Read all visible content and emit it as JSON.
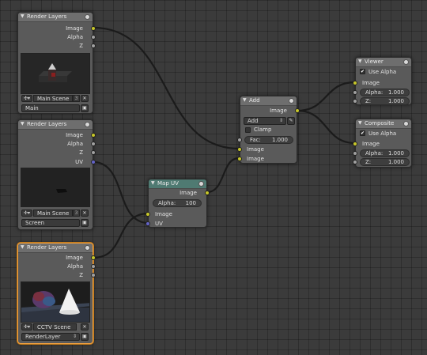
{
  "nodes": {
    "render_layers_1": {
      "title": "Render Layers",
      "outputs": [
        "Image",
        "Alpha",
        "Z"
      ],
      "scene": "Main Scene",
      "layer": "Main"
    },
    "render_layers_2": {
      "title": "Render Layers",
      "outputs": [
        "Image",
        "Alpha",
        "Z",
        "UV"
      ],
      "scene": "Main Scene",
      "layer": "Screen"
    },
    "render_layers_3": {
      "title": "Render Layers",
      "outputs": [
        "Image",
        "Alpha",
        "Z"
      ],
      "scene": "CCTV Scene",
      "layer": "RenderLayer"
    },
    "map_uv": {
      "title": "Map UV",
      "output": "Image",
      "alpha_label": "Alpha:",
      "alpha_value": "100",
      "inputs": [
        "Image",
        "UV"
      ]
    },
    "add": {
      "title": "Add",
      "output": "Image",
      "blend_mode": "Add",
      "clamp_label": "Clamp",
      "fac_label": "Fac:",
      "fac_value": "1.000",
      "inputs": [
        "Image",
        "Image"
      ]
    },
    "viewer": {
      "title": "Viewer",
      "use_alpha": "Use Alpha",
      "input": "Image",
      "alpha_label": "Alpha:",
      "alpha_value": "1.000",
      "z_label": "Z:",
      "z_value": "1.000"
    },
    "composite": {
      "title": "Composite",
      "use_alpha": "Use Alpha",
      "input": "Image",
      "alpha_label": "Alpha:",
      "alpha_value": "1.000",
      "z_label": "Z:",
      "z_value": "1.000"
    }
  },
  "icons": {
    "collapse": "triangle-down-icon",
    "node_toggle": "circle-icon",
    "scene": "scene-icon",
    "render": "render-icon",
    "color_picker": "eyedropper-icon"
  },
  "colors": {
    "socket_color": "#c7c729",
    "socket_value": "#a1a1a1",
    "socket_vector": "#6363c7",
    "selected_outline": "#f0a040",
    "map_uv_header": "#4f7a72"
  }
}
